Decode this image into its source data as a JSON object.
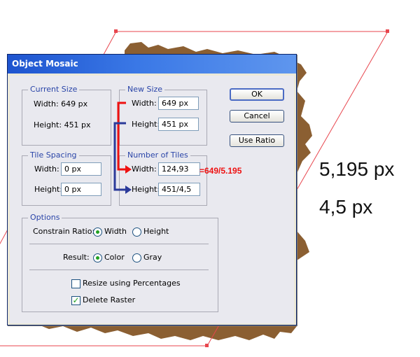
{
  "dialog": {
    "title": "Object Mosaic",
    "current_size": {
      "legend": "Current Size",
      "width_text": "Width: 649 px",
      "height_text": "Height: 451 px"
    },
    "new_size": {
      "legend": "New Size",
      "width_label": "Width:",
      "width_value": "649 px",
      "height_label": "Height:",
      "height_value": "451 px"
    },
    "tile_spacing": {
      "legend": "Tile Spacing",
      "width_label": "Width:",
      "width_value": "0 px",
      "height_label": "Height:",
      "height_value": "0 px"
    },
    "number_of_tiles": {
      "legend": "Number of Tiles",
      "width_label": "Width:",
      "width_value": "124,93",
      "height_label": "Height:",
      "height_value": "451/4,5"
    },
    "options": {
      "legend": "Options",
      "constrain_label": "Constrain Ratio:",
      "constrain_width": "Width",
      "constrain_height": "Height",
      "result_label": "Result:",
      "result_color": "Color",
      "result_gray": "Gray",
      "resize_percent": "Resize using Percentages",
      "delete_raster": "Delete Raster"
    },
    "buttons": {
      "ok": "OK",
      "cancel": "Cancel",
      "use_ratio": "Use Ratio"
    }
  },
  "annotations": {
    "formula": "=649/5.195",
    "big_width": "5,195 px",
    "big_height": "4,5 px"
  },
  "colors": {
    "arrow_red": "#ee1111",
    "arrow_blue": "#2b3a9a",
    "shape_brown": "#8b5f32",
    "bounding_line": "#e8464e",
    "titlebar": "#2a62d8"
  }
}
